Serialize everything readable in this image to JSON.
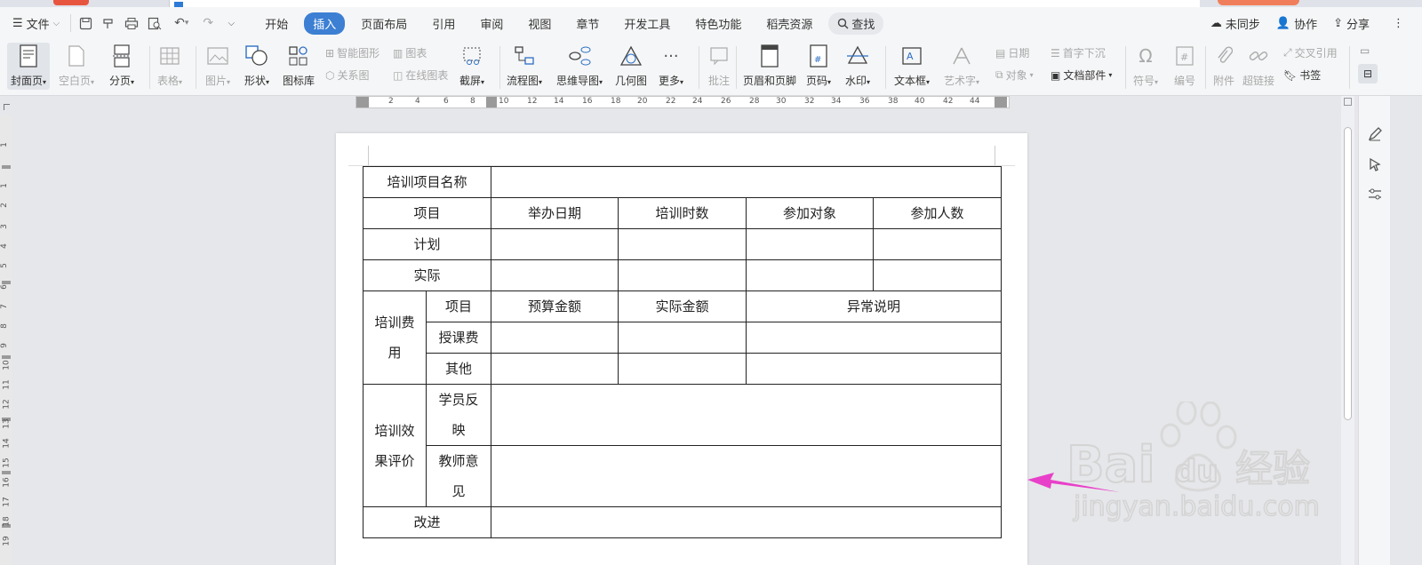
{
  "menubar": {
    "file_label": "文件",
    "tabs": [
      "开始",
      "插入",
      "页面布局",
      "引用",
      "审阅",
      "视图",
      "章节",
      "开发工具",
      "特色功能",
      "稻壳资源"
    ],
    "active_tab": "插入",
    "search_label": "查找",
    "sync_label": "未同步",
    "collab_label": "协作",
    "share_label": "分享"
  },
  "ribbon": {
    "cover": "封面页",
    "blank": "空白页",
    "pagebreak": "分页",
    "table": "表格",
    "picture": "图片",
    "shape": "形状",
    "iconlib": "图标库",
    "smartart": "智能图形",
    "chart": "图表",
    "relation": "关系图",
    "onlinechart": "在线图表",
    "screenshot": "截屏",
    "flow": "流程图",
    "mindmap": "思维导图",
    "geometry": "几何图",
    "more": "更多",
    "comment": "批注",
    "headerfooter": "页眉和页脚",
    "pagenum": "页码",
    "watermark": "水印",
    "textbox": "文本框",
    "wordart": "艺术字",
    "date": "日期",
    "object": "对象",
    "dropcap": "首字下沉",
    "docparts": "文档部件",
    "symbol": "符号",
    "numbering": "编号",
    "attachment": "附件",
    "hyperlink": "超链接",
    "crossref": "交叉引用",
    "bookmark": "书签"
  },
  "ruler": {
    "h_numbers": [
      "2",
      "4",
      "6",
      "8",
      "10",
      "12",
      "14",
      "16",
      "18",
      "20",
      "22",
      "24",
      "26",
      "28",
      "30",
      "32",
      "34",
      "36",
      "38",
      "40",
      "42",
      "44"
    ],
    "v_numbers": [
      "1",
      "1",
      "2",
      "3",
      "4",
      "5",
      "6",
      "7",
      "8",
      "9",
      "10",
      "11",
      "12",
      "13",
      "14",
      "15",
      "16",
      "17",
      "18",
      "19"
    ]
  },
  "form": {
    "r1_name": "培训项目名称",
    "r2_item": "项目",
    "r2_date": "举办日期",
    "r2_hours": "培训时数",
    "r2_target": "参加对象",
    "r2_count": "参加人数",
    "r3_plan": "计划",
    "r4_actual": "实际",
    "fee_label_1": "培训费",
    "fee_label_2": "用",
    "fee_item": "项目",
    "fee_budget": "预算金额",
    "fee_actual": "实际金额",
    "fee_note": "异常说明",
    "fee_lecture": "授课费",
    "fee_other": "其他",
    "eval_label_1": "培训效",
    "eval_label_2": "果评价",
    "eval_student_1": "学员反",
    "eval_student_2": "映",
    "eval_teacher_1": "教师意",
    "eval_teacher_2": "见",
    "improve": "改进"
  },
  "watermark": {
    "brand_en": "Bai",
    "brand_du": "du",
    "brand_cn": "经验",
    "url": "jingyan.baidu.com"
  },
  "colors": {
    "accent": "#3c7fd3",
    "arrow": "#e840c9"
  }
}
